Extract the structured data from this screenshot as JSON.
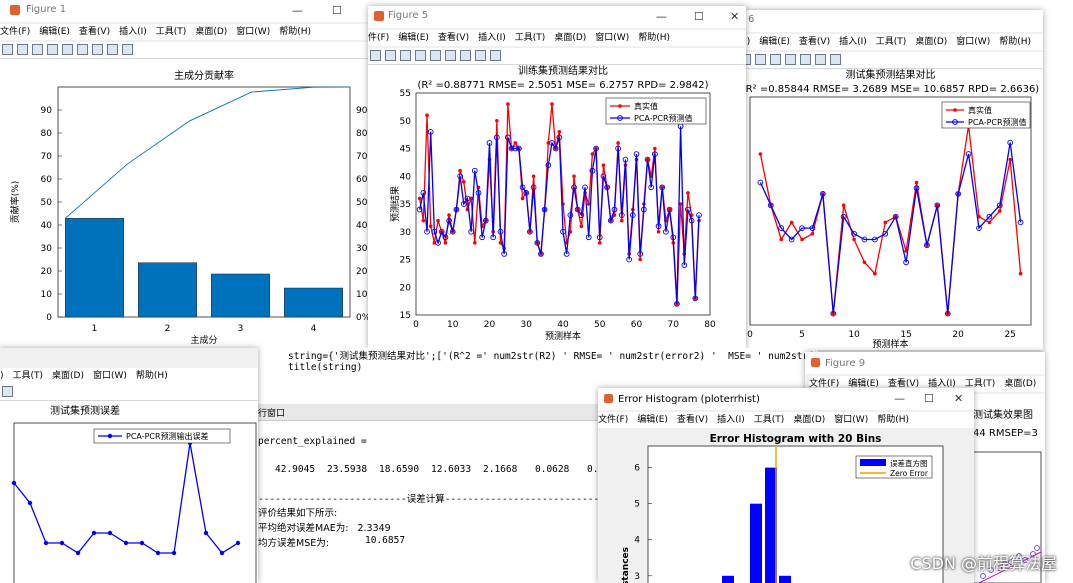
{
  "fig1": {
    "title": "Figure 1",
    "menu": [
      "文件(F)",
      "编辑(E)",
      "查看(V)",
      "插入(I)",
      "工具(T)",
      "桌面(D)",
      "窗口(W)",
      "帮助(H)"
    ],
    "chart_title": "主成分贡献率",
    "xlabel": "主成分",
    "ylabel": "贡献率(%)"
  },
  "fig5": {
    "title": "Figure 5",
    "menu": [
      "件(F)",
      "编辑(E)",
      "查看(V)",
      "插入(I)",
      "工具(T)",
      "桌面(D)",
      "窗口(W)",
      "帮助(H)"
    ],
    "chart_title": "训练集预测结果对比",
    "subtitle": "(R² =0.88771 RMSE= 2.5051 MSE= 6.2757 RPD= 2.9842)",
    "xlabel": "预测样本",
    "ylabel": "预测结果",
    "legend_true": "真实值",
    "legend_pred": "PCA-PCR预测值"
  },
  "fig6": {
    "title": "6",
    "menu": [
      "(F)",
      "编辑(E)",
      "查看(V)",
      "插入(I)",
      "工具(T)",
      "桌面(D)",
      "窗口(W)",
      "帮助(H)"
    ],
    "chart_title": "测试集预测结果对比",
    "subtitle": "(R² =0.85844 RMSE= 3.2689 MSE= 10.6857 RPD= 2.6636)",
    "xlabel": "预测样本",
    "legend_true": "真实值",
    "legend_pred": "PCA-PCR预测值"
  },
  "fig_err": {
    "menu": [
      ")",
      "工具(T)",
      "桌面(D)",
      "窗口(W)",
      "帮助(H)"
    ],
    "chart_title": "测试集预测误差",
    "legend": "PCA-PCR预测输出误差"
  },
  "editor": {
    "line1": "string={'测试集预测结果对比';['(R^2 =' num2str(R2) ' RMSE= ' num2str(error2) '  MSE= ' num2str(mse2) '  RPD= ' num2str(RPD2) ')']};",
    "line2": "title(string)"
  },
  "cmd": {
    "tab": "行窗口",
    "pe_label": "percent_explained =",
    "pe_values": [
      "42.9045",
      "23.5938",
      "18.6590",
      "12.6033",
      "2.1668",
      "0.0628",
      "0.0098"
    ],
    "sep": "--------------------------误差计算---------------------------",
    "l1": "评价结果如下所示:",
    "l2": "平均绝对误差MAE为:   2.3349",
    "l3_prefix": "均方误差MSE为:",
    "l3_value": "10.6857"
  },
  "fig9": {
    "title": "Figure 9",
    "menu": [
      "文件(F)",
      "编辑(E)",
      "查看(V)",
      "插入(I)",
      "工具(T)",
      "桌面(D)",
      "窗口(W)"
    ],
    "chart_title": "测试集效果图",
    "subtitle": "44  RMSEP=3"
  },
  "hist": {
    "title": "Error Histogram (ploterrhist)",
    "menu": [
      "文件(F)",
      "编辑(E)",
      "查看(V)",
      "插入(I)",
      "工具(T)",
      "桌面(D)",
      "窗口(W)",
      "帮助(H)"
    ],
    "chart_title": "Error Histogram with 20 Bins",
    "legend_bars": "误差直方图",
    "legend_zero": "Zero Error",
    "ylabel_partial": "istances"
  },
  "watermark": "CSDN @前程算法屋",
  "colors": {
    "bar": "#0072bd",
    "red": "#ff0000",
    "blue": "#0000ff",
    "orange": "#f0a000"
  },
  "chart_data": [
    {
      "type": "bar",
      "title": "主成分贡献率",
      "xlabel": "主成分",
      "ylabel": "贡献率(%)",
      "categories": [
        "1",
        "2",
        "3",
        "4"
      ],
      "values": [
        42.9,
        23.6,
        18.7,
        12.6
      ],
      "cumulative": [
        42.9,
        66.5,
        85.2,
        97.8,
        99.9,
        100
      ],
      "ylim": [
        0,
        100
      ],
      "y_ticks": [
        0,
        10,
        20,
        30,
        40,
        50,
        60,
        70,
        80,
        90
      ],
      "y2_ticks": [
        "0%",
        "10%",
        "20%",
        "30%",
        "40%",
        "50%",
        "60%",
        "70%",
        "80%",
        "90%"
      ]
    },
    {
      "type": "line",
      "title": "训练集预测结果对比",
      "xlabel": "预测样本",
      "ylabel": "预测结果",
      "xlim": [
        0,
        80
      ],
      "ylim": [
        15,
        55
      ],
      "x_ticks": [
        0,
        10,
        20,
        30,
        40,
        50,
        60,
        70,
        80
      ],
      "y_ticks": [
        15,
        20,
        25,
        30,
        35,
        40,
        45,
        50,
        55
      ],
      "series": [
        {
          "name": "真实值",
          "values": [
            36,
            32,
            51,
            31,
            28,
            32,
            30,
            28,
            33,
            30,
            34,
            41,
            39,
            34,
            36,
            28,
            38,
            31,
            32,
            43,
            30,
            50,
            28,
            27,
            53,
            45,
            46,
            45,
            36,
            37,
            30,
            40,
            28,
            26,
            34,
            46,
            53,
            45,
            48,
            35,
            28,
            30,
            40,
            34,
            31,
            37,
            35,
            44,
            45,
            28,
            42,
            38,
            32,
            33,
            46,
            32,
            42,
            26,
            34,
            43,
            25,
            35,
            43,
            40,
            45,
            30,
            38,
            32,
            34,
            28,
            17,
            35,
            26,
            37,
            33,
            18,
            32
          ]
        },
        {
          "name": "PCA-PCR预测值",
          "values": [
            34,
            37,
            30,
            48,
            30,
            28,
            30,
            29,
            32,
            30,
            34,
            40,
            35,
            36,
            30,
            41,
            37,
            29,
            32,
            46,
            29,
            47,
            30,
            26,
            47,
            45,
            45,
            45,
            38,
            37,
            30,
            38,
            28,
            26,
            34,
            42,
            46,
            45,
            47,
            30,
            26,
            33,
            38,
            34,
            33,
            38,
            29,
            41,
            45,
            29,
            40,
            38,
            32,
            34,
            45,
            33,
            43,
            25,
            33,
            44,
            26,
            34,
            43,
            38,
            44,
            31,
            38,
            30,
            34,
            29,
            17,
            49,
            24,
            34,
            32,
            18,
            33
          ]
        }
      ]
    },
    {
      "type": "line",
      "title": "测试集预测结果对比",
      "xlabel": "预测样本",
      "xlim": [
        0,
        27
      ],
      "x_ticks": [
        0,
        5,
        10,
        15,
        20,
        25
      ],
      "series": [
        {
          "name": "真实值",
          "values": [
            45,
            36,
            30,
            33,
            30,
            31,
            38,
            17,
            36,
            30,
            26,
            24,
            33,
            34,
            28,
            40,
            29,
            36,
            17,
            38,
            50,
            34,
            33,
            35,
            44,
            24
          ]
        },
        {
          "name": "PCA-PCR预测值",
          "values": [
            40,
            36,
            32,
            30,
            32,
            32,
            38,
            17,
            34,
            31,
            30,
            30,
            31,
            34,
            26,
            39,
            29,
            36,
            17,
            38,
            45,
            32,
            34,
            36,
            47,
            33
          ]
        }
      ]
    },
    {
      "type": "line",
      "title": "测试集预测误差",
      "series": [
        {
          "name": "PCA-PCR预测输出误差",
          "values": [
            4,
            2,
            -2,
            -2,
            -3,
            -1,
            -1,
            -2,
            -2,
            -3,
            -3,
            8,
            -1,
            -3,
            -2
          ]
        }
      ]
    },
    {
      "type": "bar",
      "title": "Error Histogram with 20 Bins",
      "y_ticks": [
        3,
        4,
        5,
        6
      ],
      "bins": [
        3,
        5,
        6,
        3
      ]
    }
  ]
}
